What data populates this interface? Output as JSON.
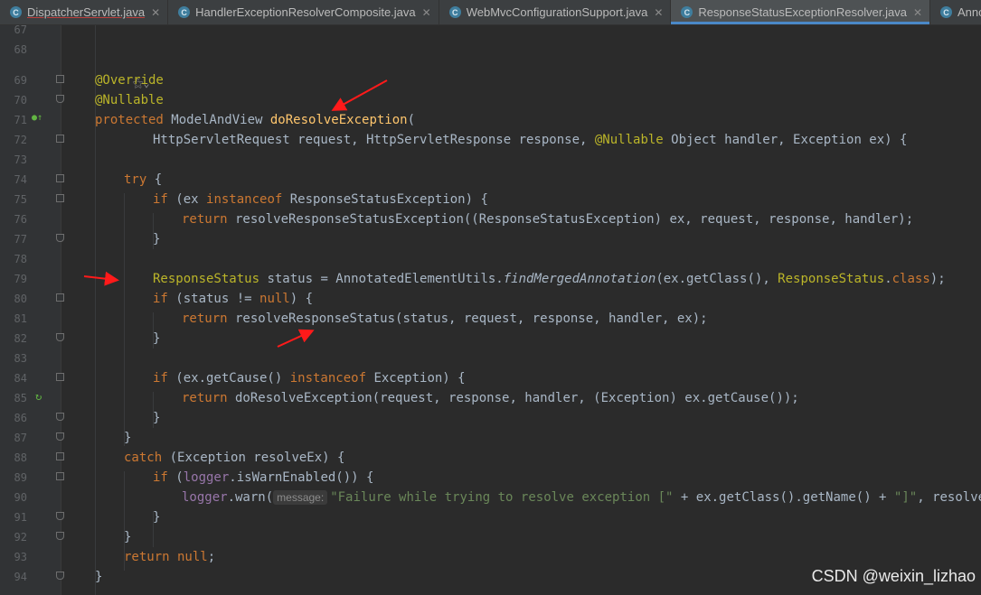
{
  "tabs": [
    {
      "label": "DispatcherServlet.java",
      "icon": "C",
      "active": false,
      "underline": true,
      "close": "✕"
    },
    {
      "label": "HandlerExceptionResolverComposite.java",
      "icon": "C",
      "active": false,
      "underline": false,
      "close": "✕"
    },
    {
      "label": "WebMvcConfigurationSupport.java",
      "icon": "C",
      "active": false,
      "underline": false,
      "close": "✕"
    },
    {
      "label": "ResponseStatusExceptionResolver.java",
      "icon": "C",
      "active": true,
      "underline": false,
      "close": "✕"
    },
    {
      "label": "Annotated",
      "icon": "C",
      "active": false,
      "underline": false,
      "close": ""
    }
  ],
  "line_numbers": [
    "67",
    "68",
    "69",
    "70",
    "71",
    "72",
    "73",
    "74",
    "75",
    "76",
    "77",
    "78",
    "79",
    "80",
    "81",
    "82",
    "83",
    "84",
    "85",
    "86",
    "87",
    "88",
    "89",
    "90",
    "91",
    "92",
    "93",
    "94"
  ],
  "code": {
    "l69": "@Override",
    "l70": "@Nullable",
    "l71_kw": "protected",
    "l71_type": " ModelAndView ",
    "l71_fn": "doResolveException",
    "l71_rest": "(",
    "l72_a": "HttpServletRequest request, HttpServletResponse response, ",
    "l72_ann": "@Nullable",
    "l72_b": " Object handler, Exception ex) {",
    "l74_kw": "try",
    "l74_rest": " {",
    "l75_kw": "if",
    "l75_a": " (ex ",
    "l75_kw2": "instanceof",
    "l75_b": " ResponseStatusException) {",
    "l76_kw": "return",
    "l76_rest": " resolveResponseStatusException((ResponseStatusException) ex, request, response, handler);",
    "l77": "}",
    "l79_ann": "ResponseStatus",
    "l79_a": " status = AnnotatedElementUtils.",
    "l79_it": "findMergedAnnotation",
    "l79_b": "(ex.getClass(), ",
    "l79_ann2": "ResponseStatus",
    "l79_c": ".",
    "l79_kw": "class",
    "l79_d": ");",
    "l80_kw": "if",
    "l80_a": " (status != ",
    "l80_kw2": "null",
    "l80_b": ") {",
    "l81_kw": "return",
    "l81_rest": " resolveResponseStatus(status, request, response, handler, ex);",
    "l82": "}",
    "l84_kw": "if",
    "l84_a": " (ex.getCause() ",
    "l84_kw2": "instanceof",
    "l84_b": " Exception) {",
    "l85_kw": "return",
    "l85_rest": " doResolveException(request, response, handler, (Exception) ex.getCause());",
    "l86": "}",
    "l87": "}",
    "l88_kw": "catch",
    "l88_rest": " (Exception resolveEx) {",
    "l89_kw": "if",
    "l89_a": " (",
    "l89_fld": "logger",
    "l89_b": ".isWarnEnabled()) {",
    "l90_fld": "logger",
    "l90_a": ".warn(",
    "l90_hint": "message:",
    "l90_str": "\"Failure while trying to resolve exception [\"",
    "l90_b": " + ex.getClass().getName() + ",
    "l90_str2": "\"]\"",
    "l90_c": ", resolveEx);",
    "l91": "}",
    "l92": "}",
    "l93_kw": "return null",
    "l93_rest": ";",
    "l94": "}"
  },
  "watermark": "CSDN @weixin_lizhao",
  "colors": {
    "background": "#2b2b2b",
    "keyword": "#cc7832",
    "annotation": "#bbb529",
    "method": "#ffc66d",
    "string": "#6a8759",
    "field": "#9876aa",
    "text": "#a9b7c6",
    "arrow": "#ff0000"
  }
}
